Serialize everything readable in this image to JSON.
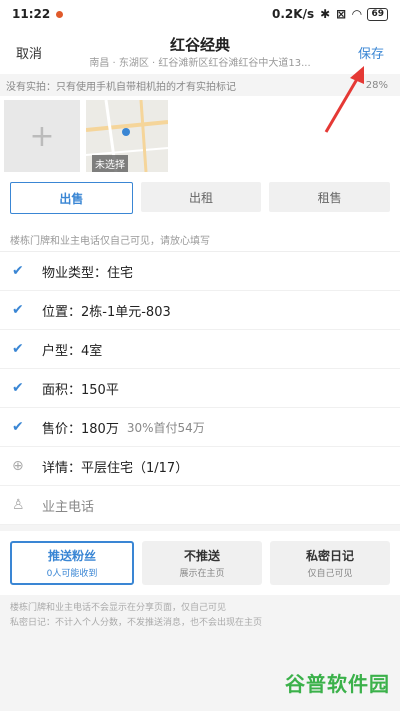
{
  "status": {
    "time": "11:22",
    "net": "0.2K/s",
    "battery": "69"
  },
  "header": {
    "cancel": "取消",
    "title": "红谷经典",
    "subtitle": "南昌 · 东湖区 · 红谷滩新区红谷滩红谷中大道13...",
    "save": "保存"
  },
  "notice": {
    "text": "没有实拍：只有使用手机自带相机拍的才有实拍标记",
    "percent": "28%"
  },
  "photos": {
    "map_label": "未选择"
  },
  "tabs": [
    {
      "label": "出售"
    },
    {
      "label": "出租"
    },
    {
      "label": "租售"
    }
  ],
  "hint": "楼栋门牌和业主电话仅自己可见，请放心填写",
  "rows": [
    {
      "label": "物业类型：住宅"
    },
    {
      "label": "位置：2栋-1单元-803"
    },
    {
      "label": "户型：4室"
    },
    {
      "label": "面积：150平"
    },
    {
      "label": "售价：180万",
      "extra": "30%首付54万"
    },
    {
      "label": "详情：平层住宅（1/17）"
    },
    {
      "label": "业主电话"
    }
  ],
  "actions": [
    {
      "title": "推送粉丝",
      "sub": "0人可能收到"
    },
    {
      "title": "不推送",
      "sub": "展示在主页"
    },
    {
      "title": "私密日记",
      "sub": "仅自己可见"
    }
  ],
  "footnote": [
    "楼栋门牌和业主电话不会显示在分享页面，仅自己可见",
    "私密日记：不计入个人分数，不发推送消息，也不会出现在主页"
  ],
  "watermark": "谷普软件园",
  "colors": {
    "accent": "#3a86d4",
    "watermark": "#3bb14a"
  }
}
